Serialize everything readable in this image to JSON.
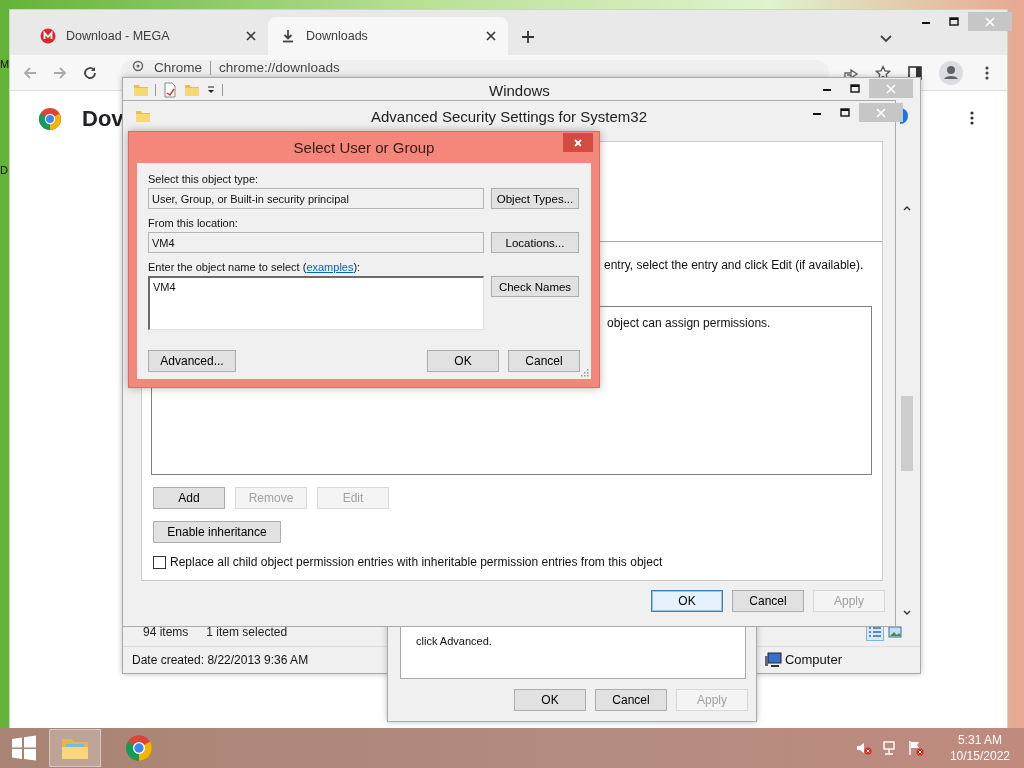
{
  "desktop": {
    "icon_labels": [
      "M",
      "D"
    ]
  },
  "browser": {
    "tabs": [
      {
        "title": "Download - MEGA",
        "kind": "mega",
        "selected": false
      },
      {
        "title": "Downloads",
        "kind": "download",
        "selected": true
      }
    ],
    "address": {
      "site": "Chrome",
      "url": "chrome://downloads"
    },
    "page_heading": "Dov"
  },
  "explorer": {
    "title": "Windows",
    "item_count": "94 items",
    "selection": "1 item selected",
    "date_created": "Date created: 8/22/2013 9:36 AM",
    "location": "Computer"
  },
  "properties_dialog": {
    "text": "click Advanced.",
    "buttons": [
      {
        "label": "OK",
        "disabled": false,
        "default": false
      },
      {
        "label": "Cancel",
        "disabled": false,
        "default": false
      },
      {
        "label": "Apply",
        "disabled": true,
        "default": false
      }
    ]
  },
  "advanced_security": {
    "title": "Advanced Security Settings for System32",
    "instruction": "entry, select the entry and click Edit (if available).",
    "list_text": "object can assign permissions.",
    "entry_buttons": [
      {
        "label": "Add",
        "disabled": false,
        "default": false
      },
      {
        "label": "Remove",
        "disabled": true,
        "default": false
      },
      {
        "label": "Edit",
        "disabled": true,
        "default": false
      }
    ],
    "inheritance_button": "Enable inheritance",
    "replace_checkbox": {
      "label": "Replace all child object permission entries with inheritable permission entries from this object",
      "checked": false
    },
    "buttons": [
      {
        "label": "OK",
        "disabled": false,
        "default": true
      },
      {
        "label": "Cancel",
        "disabled": false,
        "default": false
      },
      {
        "label": "Apply",
        "disabled": true,
        "default": false
      }
    ]
  },
  "select_dialog": {
    "title": "Select User or Group",
    "object_type": {
      "label": "Select this object type:",
      "value": "User, Group, or Built-in security principal",
      "button": "Object Types..."
    },
    "location": {
      "label": "From this location:",
      "value": "VM4",
      "button": "Locations..."
    },
    "object_name": {
      "label": "Enter the object name to select (",
      "link": "examples",
      "label_end": "):",
      "value": "VM4",
      "button": "Check Names"
    },
    "buttons": [
      {
        "label": "Advanced...",
        "disabled": false,
        "default": false
      },
      {
        "label": "OK",
        "disabled": false,
        "default": false
      },
      {
        "label": "Cancel",
        "disabled": false,
        "default": false
      }
    ]
  },
  "taskbar": {
    "apps": [
      {
        "kind": "explorer",
        "selected": true
      },
      {
        "kind": "chrome",
        "selected": false
      }
    ],
    "time": "5:31 AM",
    "date": "10/15/2022"
  }
}
